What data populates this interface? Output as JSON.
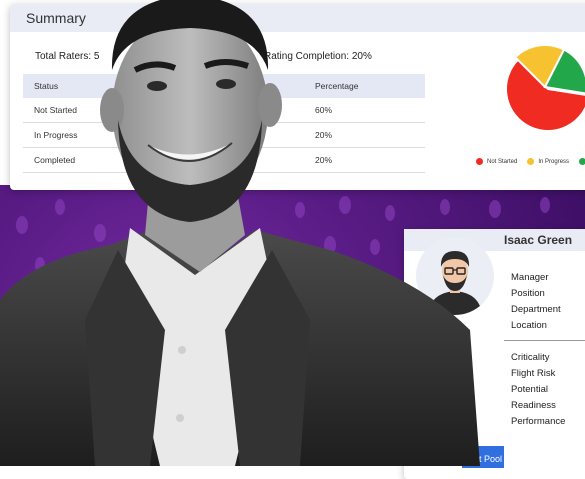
{
  "summary": {
    "title": "Summary",
    "total_raters": "Total Raters: 5",
    "rating_completion": "Rating Completion: 20%",
    "table": {
      "headers": [
        "Status",
        "Percentage"
      ],
      "rows": [
        {
          "status": "Not Started",
          "percentage": "60%"
        },
        {
          "status": "In Progress",
          "percentage": "20%"
        },
        {
          "status": "Completed",
          "percentage": "20%"
        }
      ]
    },
    "pie": {
      "slices": [
        {
          "label": "Not Started",
          "value": 60,
          "color": "#ef2b22"
        },
        {
          "label": "In Progress",
          "value": 20,
          "color": "#f7c230"
        },
        {
          "label": "Completed",
          "value": 20,
          "color": "#22a84a"
        }
      ]
    }
  },
  "profile": {
    "name": "Isaac Green",
    "fields_top": [
      "Manager",
      "Position",
      "Department",
      "Location"
    ],
    "fields_bottom": [
      "Criticality",
      "Flight Risk",
      "Potential",
      "Readiness",
      "Performance"
    ]
  },
  "pool_button": {
    "label": "t Pool"
  },
  "colors": {
    "accent": "#2f6fe0",
    "purple": "#5a1c86"
  }
}
